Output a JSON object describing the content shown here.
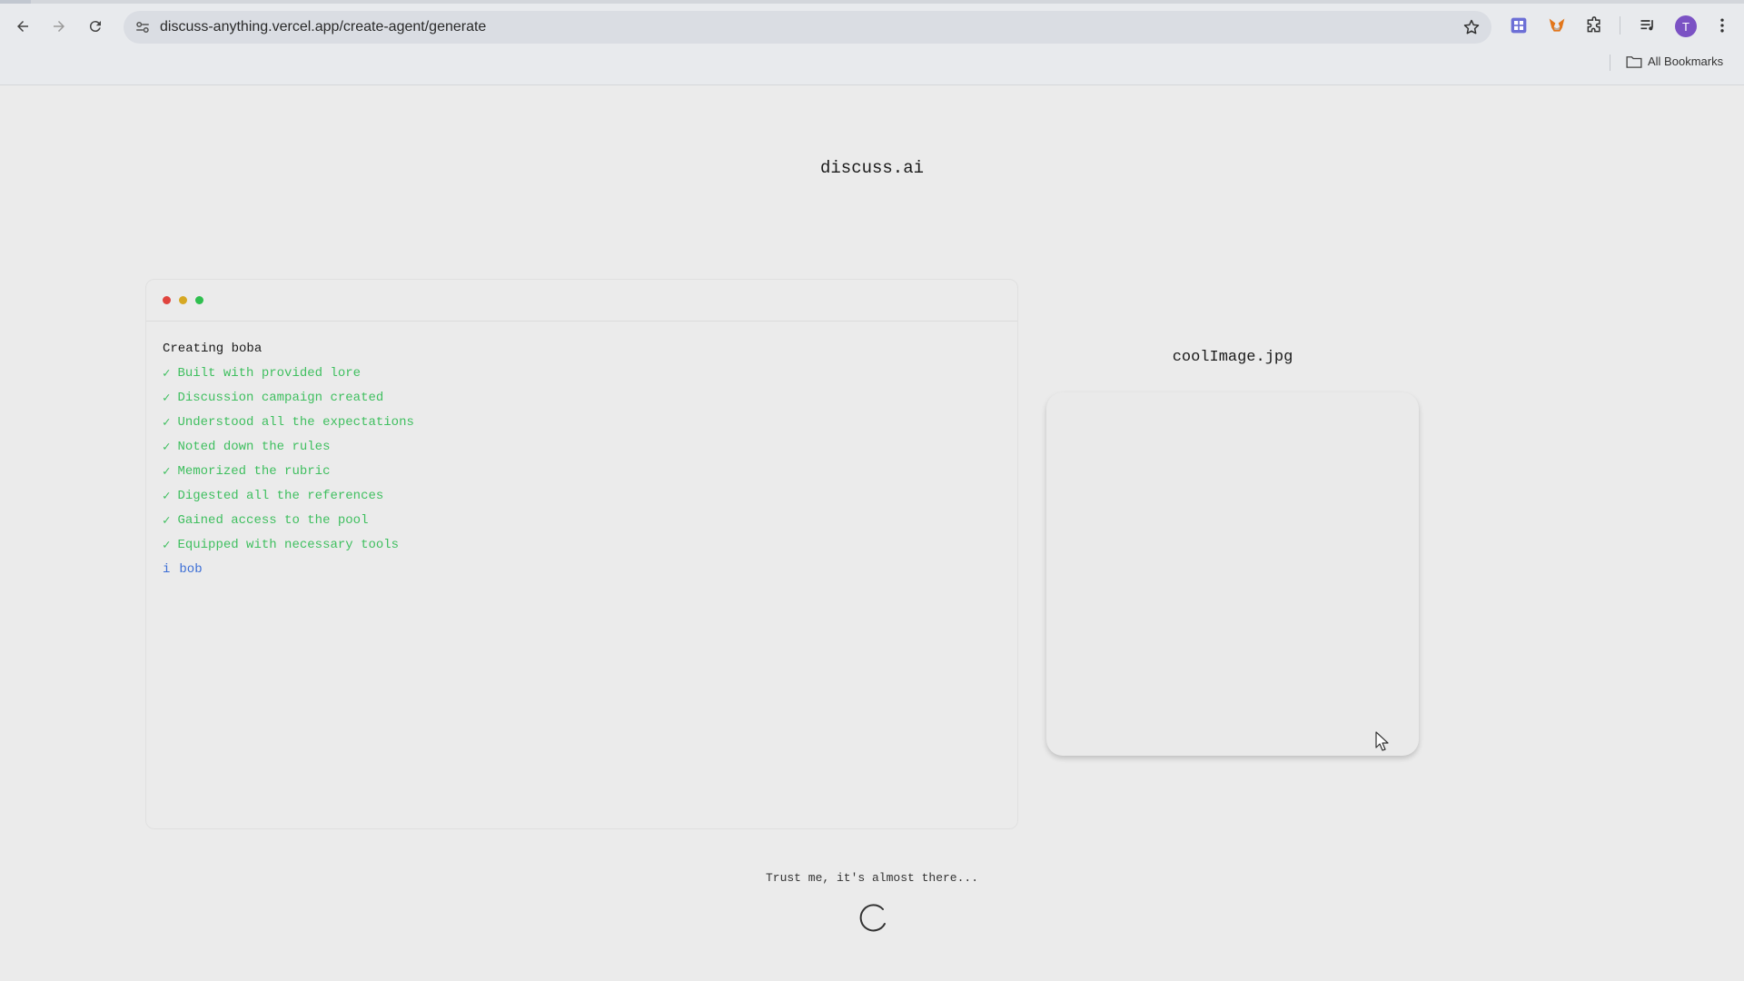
{
  "browser": {
    "url": "discuss-anything.vercel.app/create-agent/generate",
    "bookmarks_label": "All Bookmarks",
    "avatar_initial": "T",
    "accent": "#7b52c4"
  },
  "page": {
    "brand": "discuss.ai",
    "terminal": {
      "title": "Creating boba",
      "steps": [
        "Built with provided lore",
        "Discussion campaign created",
        "Understood all the expectations",
        "Noted down the rules",
        "Memorized the rubric",
        "Digested all the references",
        "Gained access to the pool",
        "Equipped with necessary tools"
      ],
      "check_glyph": "✓",
      "info_glyph": "i",
      "info_text": "bob",
      "colors": {
        "success": "#3fbf5f",
        "info": "#3d6fd6",
        "dot_red": "#e0443e",
        "dot_yellow": "#d6a823",
        "dot_green": "#2fbf4f"
      }
    },
    "image_caption": "coolImage.jpg",
    "status_text": "Trust me, it's almost there..."
  }
}
